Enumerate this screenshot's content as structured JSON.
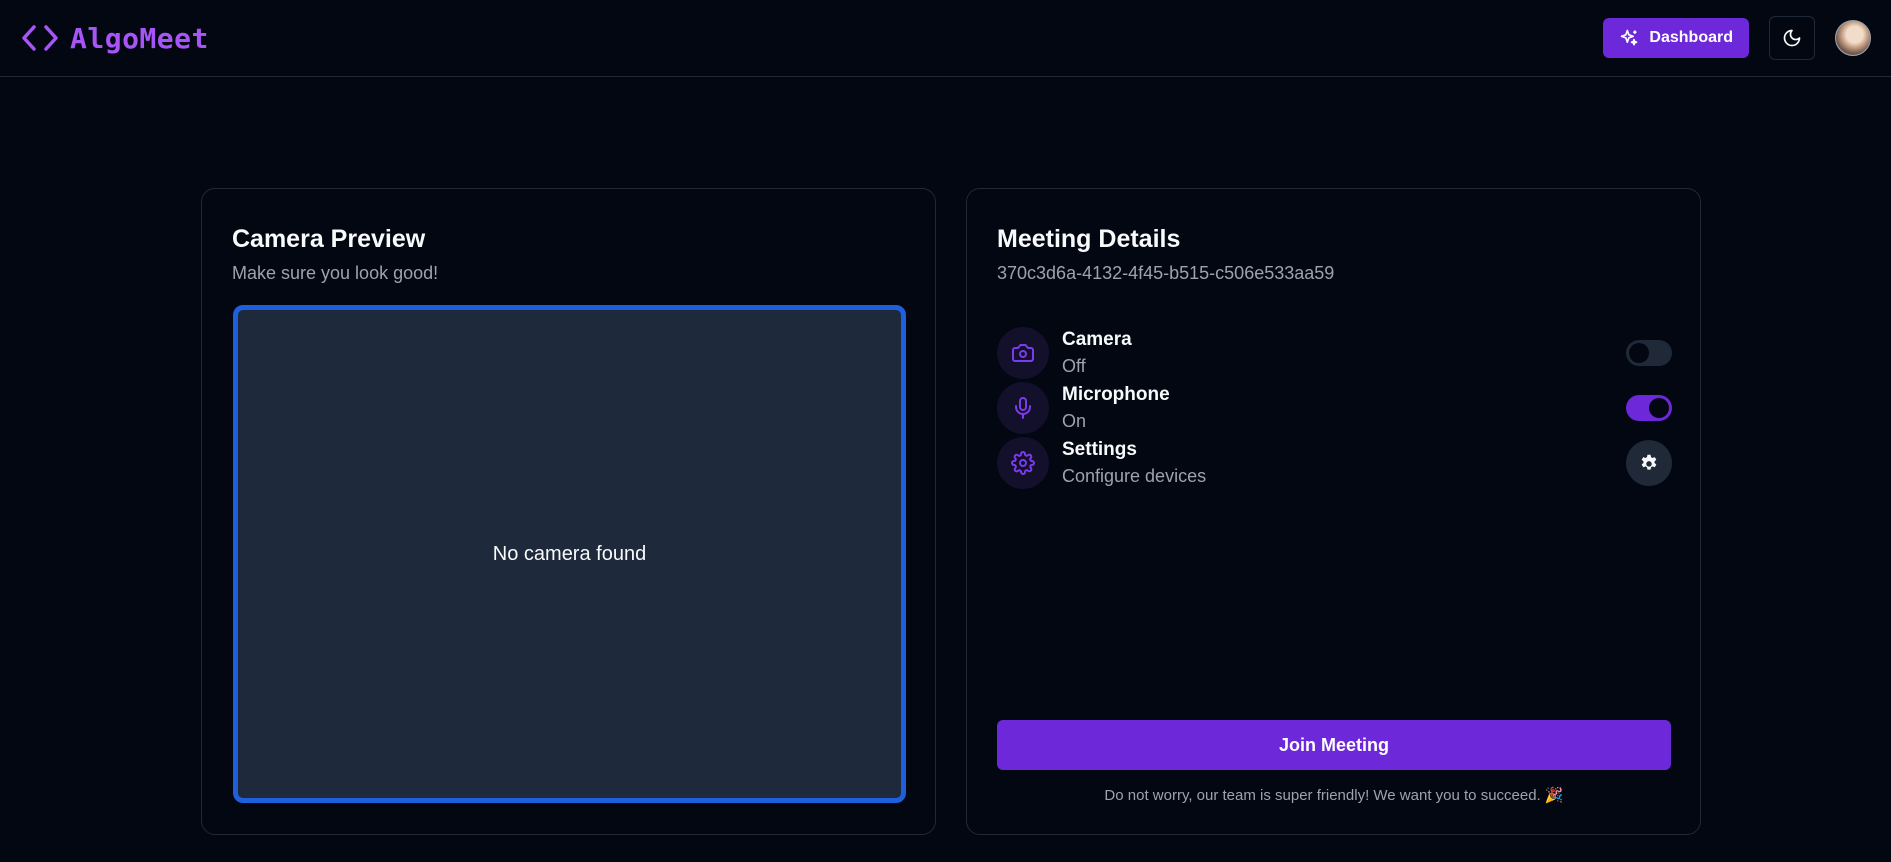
{
  "header": {
    "brand": "AlgoMeet",
    "dashboard_label": "Dashboard",
    "theme_icon": "moon-icon",
    "avatar": "user-avatar"
  },
  "camera_preview": {
    "title": "Camera Preview",
    "subtitle": "Make sure you look good!",
    "empty_text": "No camera found"
  },
  "meeting": {
    "title": "Meeting Details",
    "id": "370c3d6a-4132-4f45-b515-c506e533aa59",
    "devices": [
      {
        "name": "Camera",
        "status": "Off",
        "icon": "camera-icon",
        "enabled": false
      },
      {
        "name": "Microphone",
        "status": "On",
        "icon": "microphone-icon",
        "enabled": true
      },
      {
        "name": "Settings",
        "status": "Configure devices",
        "icon": "settings-icon"
      }
    ],
    "join_label": "Join Meeting",
    "footnote": "Do not worry, our team is super friendly! We want you to succeed. 🎉"
  },
  "colors": {
    "background": "#030712",
    "accent": "#6d28d9",
    "brand": "#a855f7",
    "preview_border": "#1d5fdd",
    "preview_bg": "#1e293b"
  }
}
